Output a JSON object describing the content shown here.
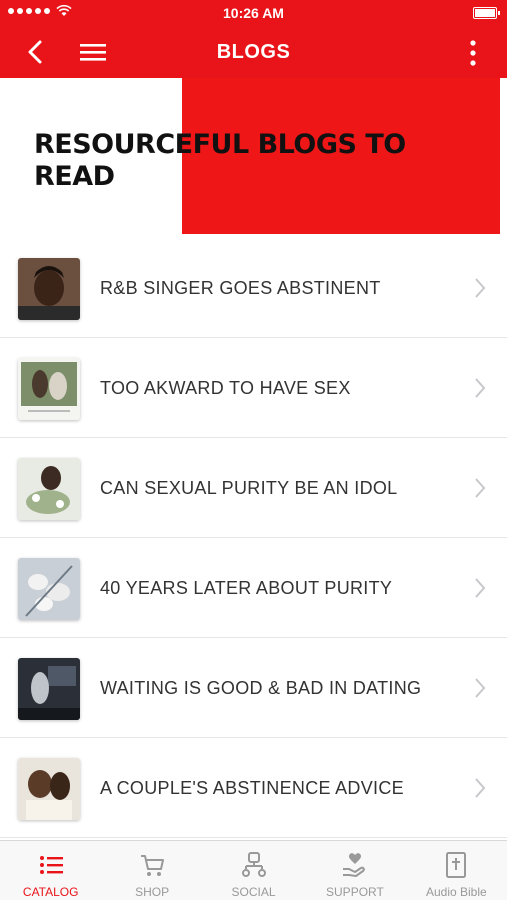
{
  "status_bar": {
    "time": "10:26 AM"
  },
  "nav": {
    "title": "BLOGS"
  },
  "hero": {
    "title": "RESOURCEFUL BLOGS TO READ"
  },
  "blogs": [
    {
      "title": "R&B SINGER GOES ABSTINENT"
    },
    {
      "title": "TOO AKWARD TO HAVE SEX"
    },
    {
      "title": "CAN SEXUAL PURITY BE AN IDOL"
    },
    {
      "title": "40 YEARS LATER ABOUT PURITY"
    },
    {
      "title": "WAITING IS GOOD & BAD IN DATING"
    },
    {
      "title": "A COUPLE'S ABSTINENCE ADVICE"
    }
  ],
  "tabs": [
    {
      "label": "CATALOG",
      "icon": "list-icon",
      "active": true
    },
    {
      "label": "SHOP",
      "icon": "cart-icon",
      "active": false
    },
    {
      "label": "SOCIAL",
      "icon": "people-icon",
      "active": false
    },
    {
      "label": "SUPPORT",
      "icon": "heart-hand-icon",
      "active": false
    },
    {
      "label": "Audio Bible",
      "icon": "bible-icon",
      "active": false
    }
  ],
  "colors": {
    "accent": "#e8141a",
    "tab_inactive": "#999999"
  }
}
